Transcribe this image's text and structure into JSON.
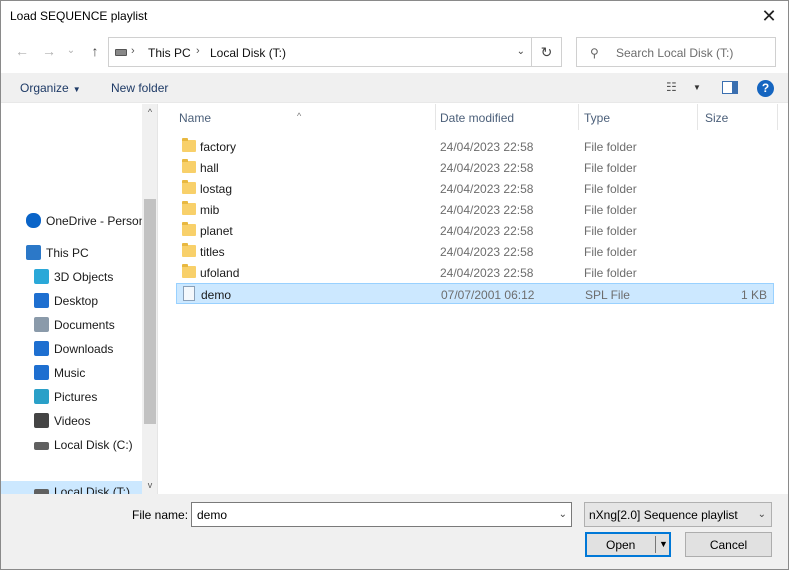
{
  "window": {
    "title": "Load SEQUENCE playlist",
    "close_glyph": "✕"
  },
  "nav": {
    "back_glyph": "←",
    "forward_glyph": "→",
    "recent_glyph": "⌄",
    "up_glyph": "↑",
    "breadcrumb": [
      "This PC",
      "Local Disk (T:)"
    ],
    "crumb_sep": "›",
    "addr_drop_glyph": "⌄",
    "refresh_glyph": "↻",
    "search_placeholder": "Search Local Disk (T:)",
    "search_glyph": "⚲"
  },
  "toolbar": {
    "organize": "Organize",
    "caret": "▼",
    "new_folder": "New folder",
    "view_glyph": "☷",
    "help": "?"
  },
  "sidebar": {
    "items": [
      {
        "label": "OneDrive - Personal",
        "icon": "cloud-icon",
        "color": "#0a64c8"
      },
      {
        "label": "This PC",
        "icon": "computer-icon",
        "color": "#2b78c8"
      },
      {
        "label": "3D Objects",
        "icon": "cube-icon",
        "color": "#2aa8d8"
      },
      {
        "label": "Desktop",
        "icon": "desktop-icon",
        "color": "#1e6fd0"
      },
      {
        "label": "Documents",
        "icon": "document-icon",
        "color": "#8a9aaa"
      },
      {
        "label": "Downloads",
        "icon": "download-icon",
        "color": "#1e6fd0"
      },
      {
        "label": "Music",
        "icon": "music-icon",
        "color": "#1e6fd0"
      },
      {
        "label": "Pictures",
        "icon": "picture-icon",
        "color": "#2aa0c8"
      },
      {
        "label": "Videos",
        "icon": "video-icon",
        "color": "#444444"
      },
      {
        "label": "Local Disk (C:)",
        "icon": "drive-icon",
        "color": "#606060"
      },
      {
        "label": "Local Disk (T:)",
        "icon": "drive-icon",
        "color": "#606060"
      }
    ],
    "scroll_up": "^",
    "scroll_down": "v"
  },
  "filelist": {
    "columns": {
      "name": "Name",
      "date": "Date modified",
      "type": "Type",
      "size": "Size"
    },
    "sort_glyph": "^",
    "rows": [
      {
        "name": "factory",
        "date": "24/04/2023 22:58",
        "type": "File folder",
        "size": "",
        "kind": "folder"
      },
      {
        "name": "hall",
        "date": "24/04/2023 22:58",
        "type": "File folder",
        "size": "",
        "kind": "folder"
      },
      {
        "name": "lostag",
        "date": "24/04/2023 22:58",
        "type": "File folder",
        "size": "",
        "kind": "folder"
      },
      {
        "name": "mib",
        "date": "24/04/2023 22:58",
        "type": "File folder",
        "size": "",
        "kind": "folder"
      },
      {
        "name": "planet",
        "date": "24/04/2023 22:58",
        "type": "File folder",
        "size": "",
        "kind": "folder"
      },
      {
        "name": "titles",
        "date": "24/04/2023 22:58",
        "type": "File folder",
        "size": "",
        "kind": "folder"
      },
      {
        "name": "ufoland",
        "date": "24/04/2023 22:58",
        "type": "File folder",
        "size": "",
        "kind": "folder"
      },
      {
        "name": "demo",
        "date": "07/07/2001 06:12",
        "type": "SPL File",
        "size": "1 KB",
        "kind": "file",
        "selected": true
      }
    ]
  },
  "footer": {
    "filename_label": "File name:",
    "filename_value": "demo",
    "filetype_value": "nXng[2.0] Sequence playlist",
    "drop_glyph": "⌄",
    "open_label": "Open",
    "open_caret": "▼",
    "cancel_label": "Cancel"
  },
  "colors": {
    "selection": "#cce8ff",
    "selection_border": "#99d1ff",
    "accent": "#0078d7"
  }
}
